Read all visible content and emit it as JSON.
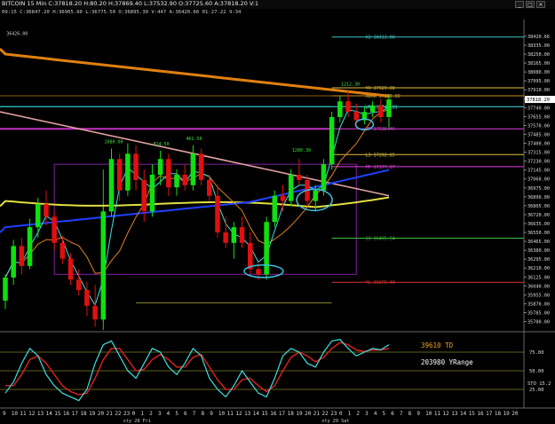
{
  "window": {
    "title": "BITCOIN  15 Min  C:37818.20  H:80.20  H:37869.40  L:37532.90  O:37725.60  A:37818.20  V:1",
    "info": "09:15  C:36847.20  H:36965.60  L:36775.50  O:36895.30  V:447  A:36420.66  01-27-22  9:34"
  },
  "chart_data": {
    "type": "candlestick",
    "title": "BITCOIN 15 Min",
    "price_axis": {
      "ylim": [
        35620,
        38580
      ],
      "ticks": [
        38420.66,
        38335,
        38250,
        38165,
        38080,
        37995,
        37910,
        37825,
        37740,
        37655,
        37570,
        37485,
        37400,
        37315,
        37230,
        37145,
        37060,
        36975,
        36890,
        36805,
        36720,
        36635,
        36550,
        36465,
        36380,
        36295,
        36210,
        36125,
        36040,
        35955,
        35870,
        35785,
        35700
      ],
      "last_price": 37818.2
    },
    "time_axis": {
      "tick_labels": [
        "9",
        "10",
        "11",
        "12",
        "13",
        "14",
        "15",
        "16",
        "17",
        "18",
        "19",
        "20",
        "21",
        "22",
        "23",
        "0",
        "1",
        "2",
        "3",
        "4",
        "5",
        "6",
        "7",
        "8",
        "9",
        "10",
        "11",
        "12",
        "13",
        "14",
        "15",
        "16",
        "17",
        "18",
        "19",
        "20",
        "21",
        "22",
        "23",
        "0",
        "1",
        "2",
        "3",
        "4",
        "5",
        "6",
        "7",
        "8",
        "9",
        "10",
        "11",
        "12",
        "13",
        "14",
        "15",
        "16",
        "17",
        "18",
        "19",
        "20"
      ],
      "day_labels": [
        {
          "text": "sty 28 Fri",
          "at": 15
        },
        {
          "text": "sty 29 Sat",
          "at": 38
        }
      ]
    },
    "candles": [
      [
        35900,
        36150,
        35820,
        36120
      ],
      [
        36120,
        36480,
        36050,
        36420
      ],
      [
        36420,
        36500,
        36150,
        36230
      ],
      [
        36230,
        36680,
        36200,
        36600
      ],
      [
        36600,
        36880,
        36500,
        36820
      ],
      [
        36820,
        36950,
        36620,
        36700
      ],
      [
        36700,
        36750,
        36380,
        36450
      ],
      [
        36450,
        36520,
        36250,
        36300
      ],
      [
        36300,
        36350,
        36050,
        36100
      ],
      [
        36100,
        36200,
        35950,
        36000
      ],
      [
        36000,
        36080,
        35750,
        35850
      ],
      [
        35850,
        36050,
        35650,
        35720
      ],
      [
        35720,
        36800,
        35700,
        36750
      ],
      [
        36750,
        37350,
        36700,
        37250
      ],
      [
        37250,
        37300,
        36850,
        36950
      ],
      [
        36950,
        37400,
        36900,
        37300
      ],
      [
        37300,
        37380,
        36950,
        37050
      ],
      [
        37050,
        37150,
        36650,
        36750
      ],
      [
        36750,
        37200,
        36700,
        37100
      ],
      [
        37100,
        37330,
        37000,
        37250
      ],
      [
        37250,
        37300,
        36900,
        36980
      ],
      [
        36980,
        37150,
        36900,
        37100
      ],
      [
        37100,
        37200,
        36950,
        37000
      ],
      [
        37000,
        37380,
        36950,
        37300
      ],
      [
        37300,
        37350,
        37000,
        37050
      ],
      [
        37050,
        37100,
        36850,
        36900
      ],
      [
        36900,
        37000,
        36500,
        36550
      ],
      [
        36550,
        36700,
        36400,
        36450
      ],
      [
        36450,
        36650,
        36300,
        36600
      ],
      [
        36600,
        36700,
        36400,
        36450
      ],
      [
        36450,
        36550,
        36150,
        36200
      ],
      [
        36200,
        36250,
        36100,
        36150
      ],
      [
        36150,
        36700,
        36100,
        36650
      ],
      [
        36650,
        36950,
        36600,
        36900
      ],
      [
        36900,
        37000,
        36750,
        36850
      ],
      [
        36850,
        37150,
        36800,
        37100
      ],
      [
        37100,
        37250,
        37000,
        37050
      ],
      [
        37050,
        37100,
        36800,
        36850
      ],
      [
        36850,
        37000,
        36750,
        36950
      ],
      [
        36950,
        37250,
        36900,
        37200
      ],
      [
        37200,
        37700,
        37150,
        37650
      ],
      [
        37650,
        37850,
        37600,
        37800
      ],
      [
        37800,
        37900,
        37650,
        37700
      ],
      [
        37700,
        37780,
        37550,
        37620
      ],
      [
        37620,
        37750,
        37580,
        37700
      ],
      [
        37700,
        37800,
        37650,
        37760
      ],
      [
        37760,
        37820,
        37600,
        37650
      ],
      [
        37650,
        37870,
        37530,
        37818
      ]
    ],
    "levels": [
      {
        "label": "H3 38413.08",
        "value": 38413,
        "color": "#40c0c0"
      },
      {
        "label": "YH 37929.00",
        "value": 37929,
        "color": "#e0c040"
      },
      {
        "label": "R0HR 37853.00",
        "value": 37853,
        "color": "#e0c040"
      },
      {
        "label": "WR3 37749.81",
        "value": 37749,
        "color": "#40e0e0"
      },
      {
        "label": "WP 37538.46",
        "value": 37538,
        "color": "#e040e0"
      },
      {
        "label": "L3 37292.05",
        "value": 37292,
        "color": "#e0c040"
      },
      {
        "label": "PP 37177.97",
        "value": 37177,
        "color": "#e040e0"
      },
      {
        "label": "S1 36495.54",
        "value": 36495,
        "color": "#40c040"
      },
      {
        "label": "YL 36075.40",
        "value": 36075,
        "color": "#e03030"
      }
    ],
    "annotations": [
      {
        "text": "1080.00",
        "i": 13,
        "v": 37400,
        "color": "#40e040"
      },
      {
        "text": "814.50",
        "i": 19,
        "v": 37380,
        "color": "#40e040"
      },
      {
        "text": "461.50",
        "i": 23,
        "v": 37430,
        "color": "#40e040"
      },
      {
        "text": "1280.30",
        "i": 36,
        "v": 37320,
        "color": "#40e040"
      },
      {
        "text": "1212.30",
        "i": 42,
        "v": 37950,
        "color": "#40e040"
      },
      {
        "text": "36426.00",
        "i": 1,
        "v": 38430,
        "color": "#cccccc"
      }
    ],
    "oscillator": {
      "labels": {
        "td": "39610 TD",
        "yrange": "203980 YRange",
        "sto": "STO 15.2"
      },
      "ticks": [
        25,
        50,
        75
      ],
      "fast": [
        20,
        35,
        60,
        80,
        70,
        45,
        30,
        20,
        15,
        10,
        25,
        60,
        85,
        90,
        70,
        50,
        40,
        60,
        80,
        75,
        55,
        45,
        60,
        80,
        70,
        40,
        25,
        15,
        30,
        50,
        35,
        20,
        15,
        40,
        70,
        80,
        75,
        60,
        55,
        75,
        90,
        92,
        80,
        70,
        75,
        80,
        78,
        85
      ],
      "slow": [
        30,
        30,
        45,
        65,
        70,
        60,
        45,
        30,
        22,
        18,
        20,
        40,
        65,
        80,
        80,
        65,
        50,
        52,
        65,
        72,
        65,
        55,
        55,
        68,
        72,
        55,
        38,
        25,
        25,
        38,
        40,
        30,
        22,
        30,
        50,
        68,
        75,
        70,
        62,
        68,
        80,
        88,
        85,
        78,
        76,
        78,
        78,
        80
      ]
    }
  }
}
